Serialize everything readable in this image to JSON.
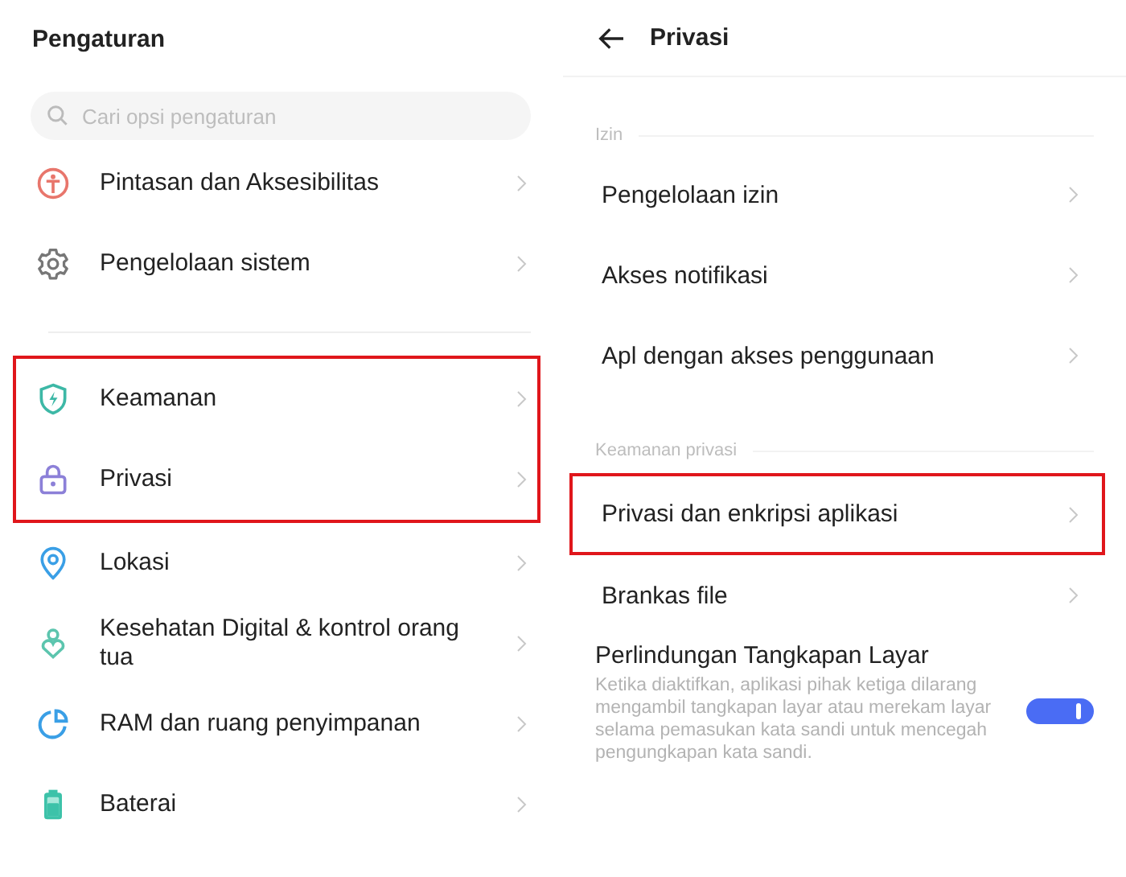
{
  "settings_panel": {
    "title": "Pengaturan",
    "search": {
      "placeholder": "Cari opsi pengaturan"
    },
    "sections": [
      {
        "divider": false,
        "highlighted": false,
        "items": [
          {
            "label": "Pintasan dan Aksesibilitas"
          },
          {
            "label": "Pengelolaan sistem"
          }
        ]
      },
      {
        "divider": true,
        "highlighted": true,
        "items": [
          {
            "label": "Keamanan"
          },
          {
            "label": "Privasi"
          }
        ]
      },
      {
        "divider": false,
        "highlighted": false,
        "items": [
          {
            "label": "Lokasi"
          },
          {
            "label": "Kesehatan Digital & kontrol orang tua"
          },
          {
            "label": "RAM dan ruang penyimpanan"
          },
          {
            "label": "Baterai"
          }
        ]
      }
    ]
  },
  "privacy_panel": {
    "title": "Privasi",
    "sections": [
      {
        "label": "Izin",
        "items": [
          {
            "kind": "link",
            "title": "Pengelolaan izin",
            "highlighted": false
          },
          {
            "kind": "link",
            "title": "Akses notifikasi",
            "highlighted": false
          },
          {
            "kind": "link",
            "title": "Apl dengan akses penggunaan",
            "highlighted": false
          }
        ]
      },
      {
        "label": "Keamanan privasi",
        "items": [
          {
            "kind": "link",
            "title": "Privasi dan enkripsi aplikasi",
            "highlighted": true
          },
          {
            "kind": "link",
            "title": "Brankas file",
            "highlighted": false
          },
          {
            "kind": "toggle",
            "title": "Perlindungan Tangkapan Layar",
            "description": "Ketika diaktifkan, aplikasi pihak ketiga dilarang mengambil tangkapan layar atau merekam layar selama pemasukan kata sandi untuk mencegah pengungkapan kata sandi.",
            "on": true,
            "highlighted": false
          }
        ]
      }
    ]
  }
}
